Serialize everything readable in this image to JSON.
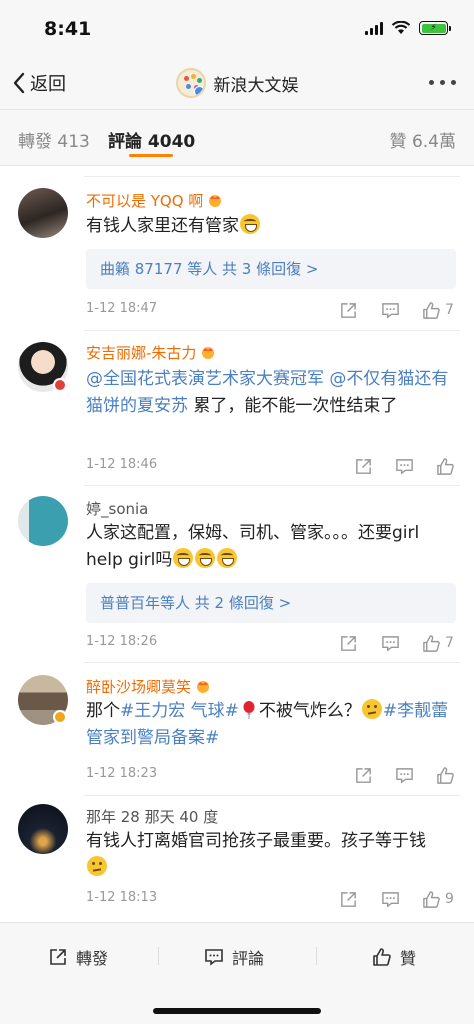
{
  "status_bar": {
    "time": "8:41"
  },
  "nav": {
    "back_label": "返回",
    "title": "新浪大文娱"
  },
  "tabs": {
    "repost": "轉發 413",
    "comments": "評論 4040",
    "likes": "贊 6.4萬"
  },
  "comments": [
    {
      "name": "不可以是 YQQ 啊",
      "name_color": "orange",
      "text": "有钱人家里还有管家",
      "reply_summary": "曲籟 87177 等人 共 3 條回復 >",
      "time": "1-12 18:47",
      "likes": "7"
    },
    {
      "name": "安吉丽娜-朱古力",
      "name_color": "orange",
      "mention1": "@全国花式表演艺术家大赛冠军",
      "mention2": "@不仅有猫还有猫饼的夏安苏",
      "text_tail": "累了，能不能一次性结束了",
      "time": "1-12 18:46",
      "likes": ""
    },
    {
      "name": "婷_sonia",
      "name_color": "gray",
      "text": "人家这配置，保姆、司机、管家。。。还要girl help girl吗",
      "reply_summary": "普普百年等人 共 2 條回復 >",
      "time": "1-12 18:26",
      "likes": "7"
    },
    {
      "name": "醉卧沙场卿莫笑",
      "name_color": "orange",
      "text_head": "那个",
      "hashtag1": "#王力宏 气球#",
      "text_mid": "不被气炸么？",
      "hashtag2": "#李靓蕾管家到警局备案#",
      "time": "1-12 18:23",
      "likes": ""
    },
    {
      "name": "那年 28 那天 40 度",
      "name_color": "gray",
      "text": "有钱人打离婚官司抢孩子最重要。孩子等于钱",
      "time": "1-12 18:13",
      "likes": "9"
    }
  ],
  "bottom_bar": {
    "repost": "轉發",
    "comment": "評論",
    "like": "贊"
  },
  "colors": {
    "accent": "#ff8200",
    "link": "#4a7fc0",
    "vip_name": "#f06c00"
  },
  "icons": [
    "back-chevron-icon",
    "more-icon",
    "share-icon",
    "comment-icon",
    "thumbs-up-icon",
    "crown-icon",
    "laugh-emoji-icon",
    "balloon-icon",
    "thinking-emoji-icon"
  ]
}
